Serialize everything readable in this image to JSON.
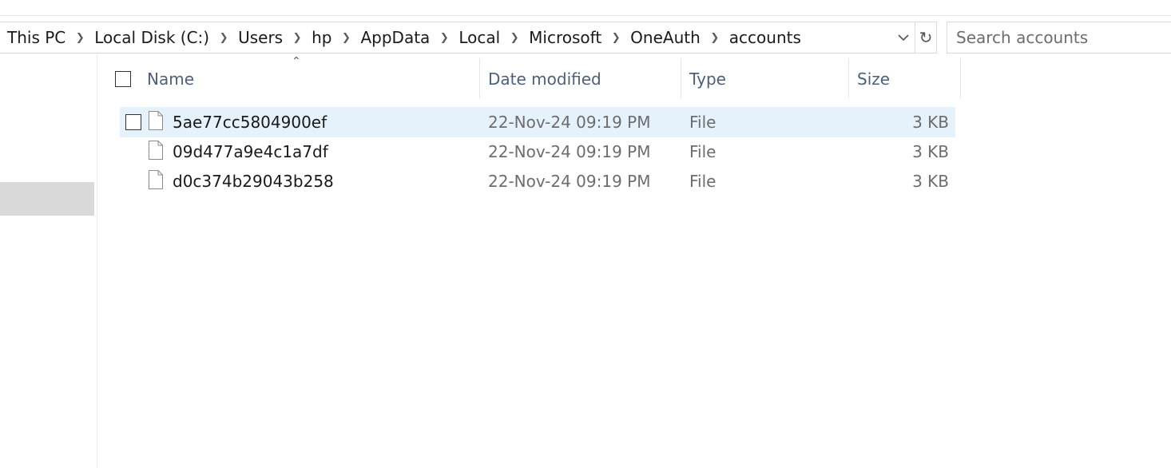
{
  "address_bar": {
    "breadcrumbs": [
      "This PC",
      "Local Disk (C:)",
      "Users",
      "hp",
      "AppData",
      "Local",
      "Microsoft",
      "OneAuth",
      "accounts"
    ],
    "separator_icon": "chevron-right-icon",
    "dropdown_icon": "chevron-down-icon"
  },
  "refresh": {
    "icon": "refresh-icon",
    "glyph": "↻"
  },
  "search": {
    "placeholder": "Search accounts",
    "value": ""
  },
  "columns": {
    "name": "Name",
    "date_modified": "Date modified",
    "type": "Type",
    "size": "Size",
    "sorted_by": "Name"
  },
  "files": [
    {
      "name": "5ae77cc5804900ef",
      "date_modified": "22-Nov-24 09:19 PM",
      "type": "File",
      "size": "3 KB",
      "selected": true
    },
    {
      "name": "09d477a9e4c1a7df",
      "date_modified": "22-Nov-24 09:19 PM",
      "type": "File",
      "size": "3 KB",
      "selected": false
    },
    {
      "name": "d0c374b29043b258",
      "date_modified": "22-Nov-24 09:19 PM",
      "type": "File",
      "size": "3 KB",
      "selected": false
    }
  ],
  "colors": {
    "selection": "#e5f1fb",
    "header_text": "#4c607a",
    "nav_selected": "#d9d9d9"
  }
}
